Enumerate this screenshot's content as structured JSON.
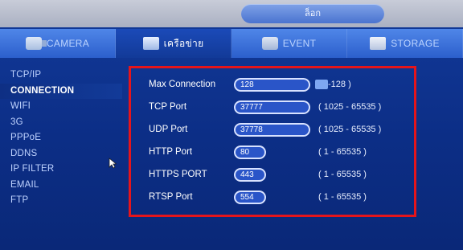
{
  "window": {
    "title": "ล็อก"
  },
  "tabs": [
    {
      "label": "CAMERA",
      "icon": "camera-icon",
      "active": false
    },
    {
      "label": "เครือข่าย",
      "icon": "network-icon",
      "active": true
    },
    {
      "label": "EVENT",
      "icon": "event-icon",
      "active": false
    },
    {
      "label": "STORAGE",
      "icon": "storage-icon",
      "active": false
    }
  ],
  "sidebar": {
    "items": [
      {
        "label": "TCP/IP"
      },
      {
        "label": "CONNECTION",
        "active": true
      },
      {
        "label": "WIFI"
      },
      {
        "label": "3G"
      },
      {
        "label": "PPPoE"
      },
      {
        "label": "DDNS"
      },
      {
        "label": "IP FILTER"
      },
      {
        "label": "EMAIL"
      },
      {
        "label": "FTP"
      }
    ]
  },
  "connection": {
    "fields": [
      {
        "label": "Max Connection",
        "value": "128",
        "range": "-128 )"
      },
      {
        "label": "TCP Port",
        "value": "37777",
        "range": "( 1025 - 65535 )"
      },
      {
        "label": "UDP Port",
        "value": "37778",
        "range": "( 1025 - 65535 )"
      },
      {
        "label": "HTTP Port",
        "value": "80",
        "range": "( 1 - 65535 )"
      },
      {
        "label": "HTTPS PORT",
        "value": "443",
        "range": "( 1 - 65535 )"
      },
      {
        "label": "RTSP Port",
        "value": "554",
        "range": "( 1 - 65535 )"
      }
    ]
  },
  "colors": {
    "highlight_border": "#e5151b",
    "active_tab": "#123a98",
    "tab_bar": "#2c5fcc"
  }
}
